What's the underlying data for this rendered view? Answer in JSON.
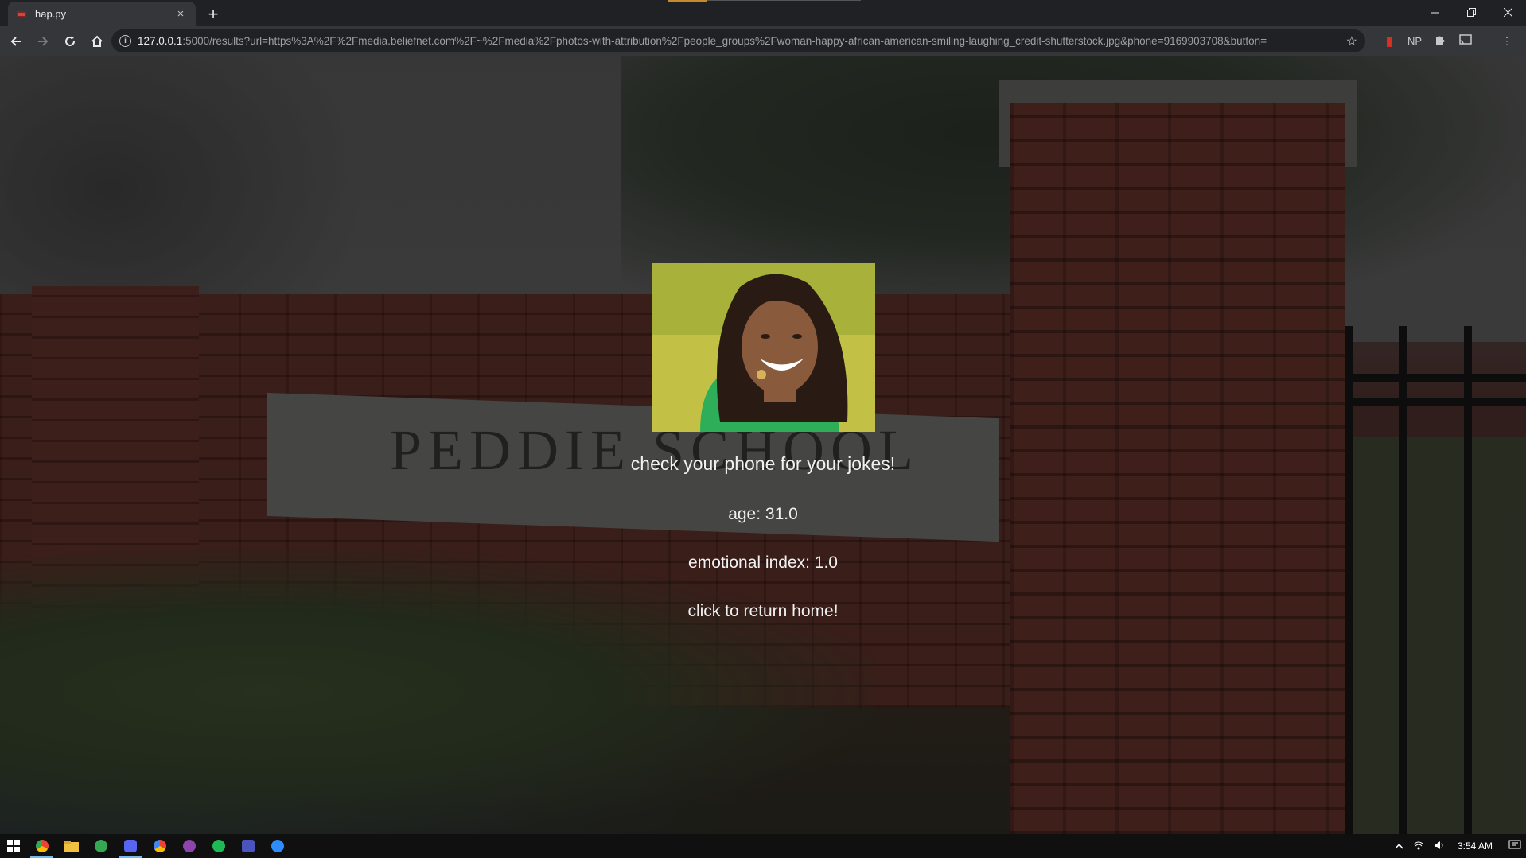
{
  "browser": {
    "tab_title": "hap.py",
    "tab_close": "×",
    "new_tab": "+",
    "url_host": "127.0.0.1",
    "url_rest": ":5000/results?url=https%3A%2F%2Fmedia.beliefnet.com%2F~%2Fmedia%2Fphotos-with-attribution%2Fpeople_groups%2Fwoman-happy-african-american-smiling-laughing_credit-shutterstock.jpg&phone=9169903708&button=",
    "extensions": [
      "NP"
    ]
  },
  "background": {
    "sign_text": "PEDDIE SCHOOL"
  },
  "results": {
    "message": "check your phone for your jokes!",
    "age": "age: 31.0",
    "emotional_index": "emotional index: 1.0",
    "return_home": "click to return home!"
  },
  "taskbar": {
    "apps": [
      "chrome",
      "file-explorer",
      "chrome-alt",
      "discord",
      "chrome-colored",
      "podcast",
      "spotify",
      "teams",
      "zoom"
    ],
    "clock": "3:54 AM",
    "colors": {
      "chrome": "#f2c94c",
      "file-explorer": "#f0c040",
      "chrome-alt": "#34a853",
      "discord": "#5865f2",
      "chrome-colored": "#ea4335",
      "podcast": "#8e44ad",
      "spotify": "#1db954",
      "teams": "#4b53bc",
      "zoom": "#2d8cff"
    }
  }
}
